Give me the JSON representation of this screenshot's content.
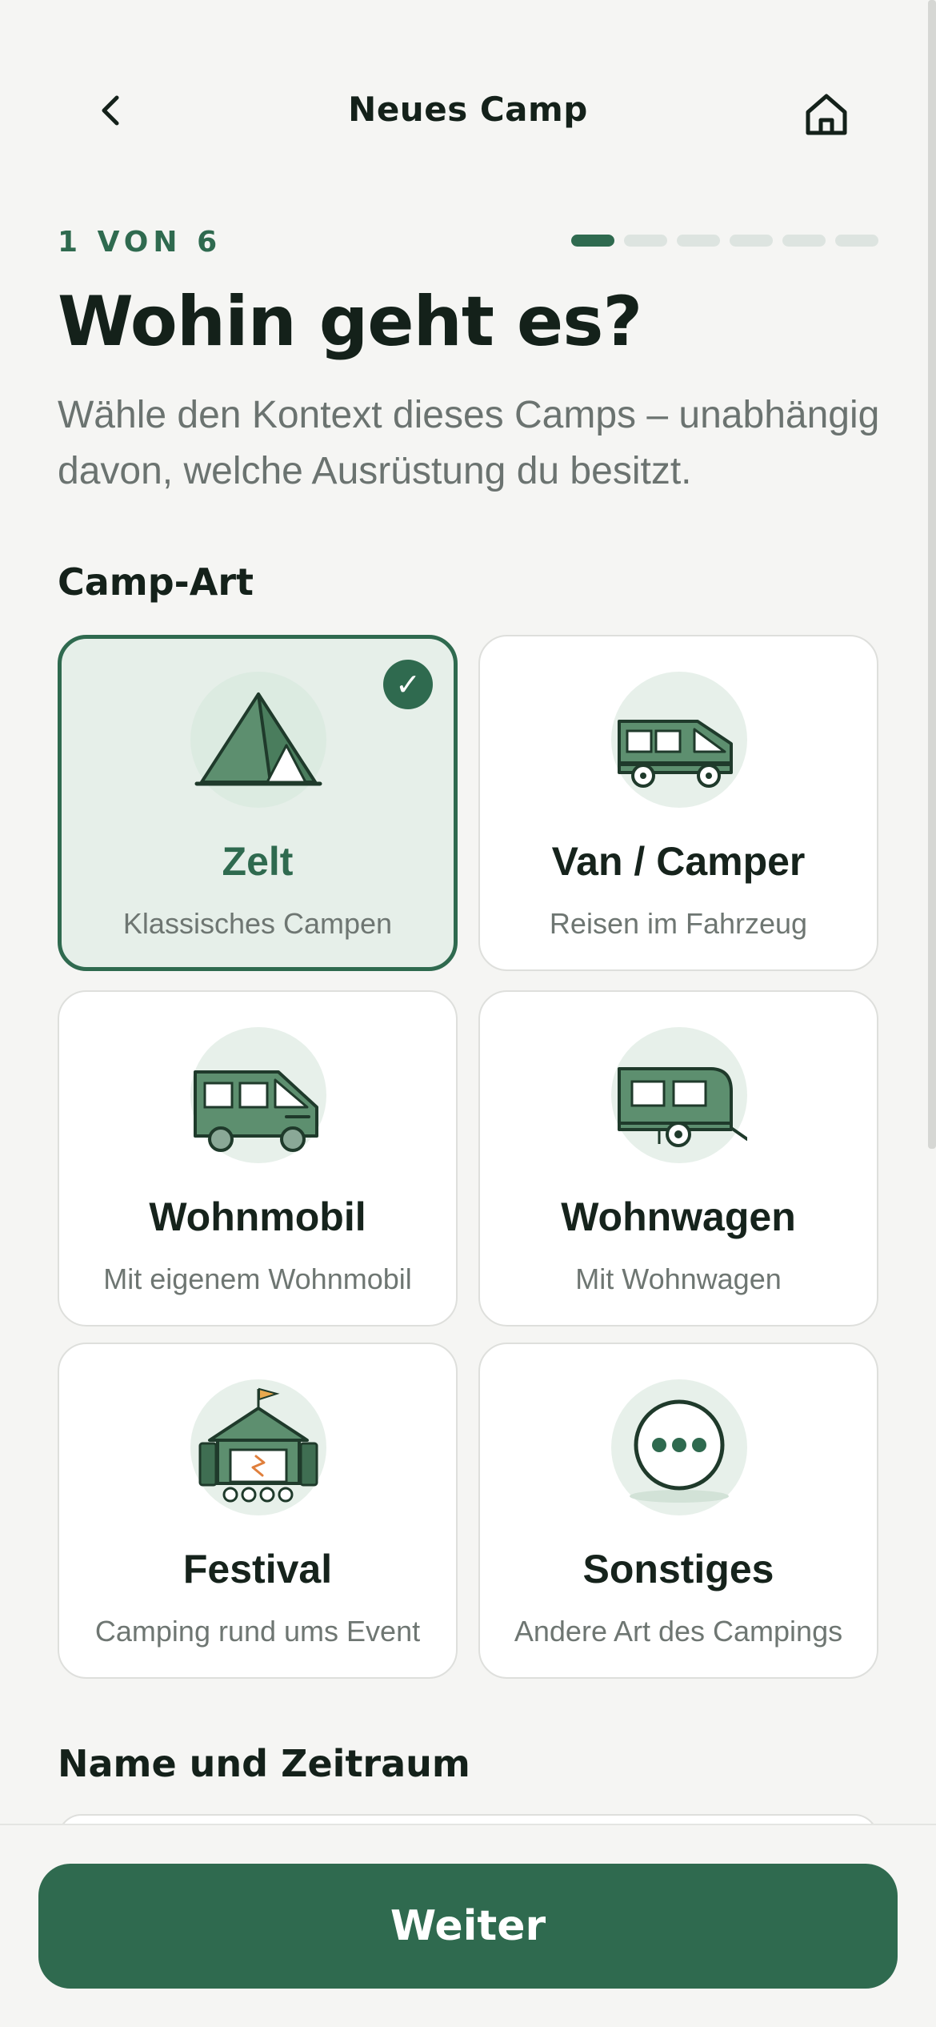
{
  "header": {
    "title": "Neues Camp",
    "back_icon": "chevron-left-icon",
    "home_icon": "home-icon"
  },
  "progress": {
    "step_label": "1 VON 6",
    "current_step": 1,
    "total_steps": 6
  },
  "intro": {
    "headline": "Wohin geht es?",
    "subtitle": "Wähle den Kontext dieses Camps – unabhängig davon, welche Ausrüstung du besitzt."
  },
  "camp_type": {
    "section_title": "Camp-Art",
    "options": [
      {
        "label": "Zelt",
        "sub": "Klassisches Campen",
        "icon": "tent-icon",
        "selected": true
      },
      {
        "label": "Van / Camper",
        "sub": "Reisen im Fahrzeug",
        "icon": "van-icon",
        "selected": false
      },
      {
        "label": "Wohnmobil",
        "sub": "Mit eigenem Wohnmobil",
        "icon": "motorhome-icon",
        "selected": false
      },
      {
        "label": "Wohnwagen",
        "sub": "Mit Wohnwagen",
        "icon": "caravan-icon",
        "selected": false
      },
      {
        "label": "Festival",
        "sub": "Camping rund ums Event",
        "icon": "festival-stage-icon",
        "selected": false
      },
      {
        "label": "Sonstiges",
        "sub": "Andere Art des Campings",
        "icon": "more-dots-icon",
        "selected": false
      }
    ]
  },
  "name_section": {
    "section_title": "Name und Zeitraum"
  },
  "footer": {
    "primary_label": "Weiter"
  },
  "colors": {
    "accent": "#2f6a4f",
    "icon_fill": "#5d8f6f",
    "background": "#f5f5f3"
  }
}
